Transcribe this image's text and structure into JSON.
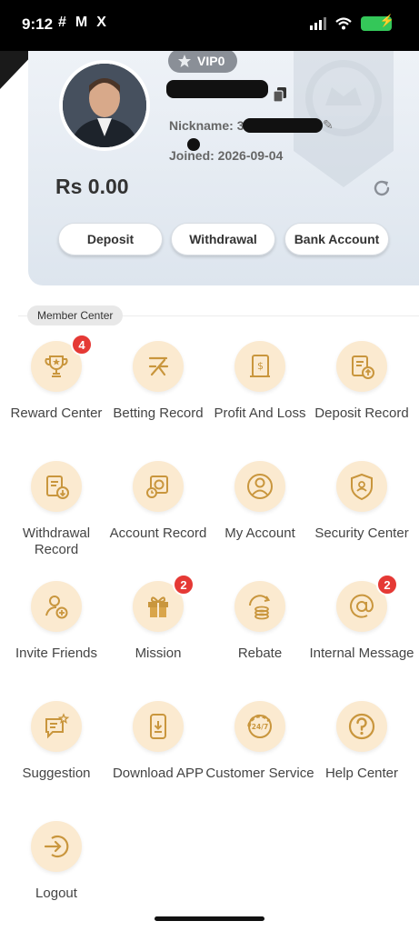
{
  "status_bar": {
    "time": "9:12",
    "apps": [
      "#",
      "M",
      "X"
    ]
  },
  "profile": {
    "vip_label": "VIP0",
    "nickname_label": "Nickname:",
    "nickname_value": "3",
    "joined_label": "Joined:",
    "joined_value": "2026-09-04",
    "balance": "Rs 0.00"
  },
  "actions": {
    "deposit": "Deposit",
    "withdrawal": "Withdrawal",
    "bank_account": "Bank Account"
  },
  "member_center": {
    "label": "Member Center",
    "items": [
      {
        "label": "Reward Center",
        "icon": "trophy-icon",
        "badge": "4"
      },
      {
        "label": "Betting Record",
        "icon": "spark-icon",
        "badge": ""
      },
      {
        "label": "Profit And Loss",
        "icon": "invoice-icon",
        "badge": ""
      },
      {
        "label": "Deposit Record",
        "icon": "clipboard-up-icon",
        "badge": ""
      },
      {
        "label": "Withdrawal Record",
        "icon": "clipboard-down-icon",
        "badge": ""
      },
      {
        "label": "Account Record",
        "icon": "history-icon",
        "badge": ""
      },
      {
        "label": "My Account",
        "icon": "user-icon",
        "badge": ""
      },
      {
        "label": "Security Center",
        "icon": "shield-icon",
        "badge": ""
      },
      {
        "label": "Invite Friends",
        "icon": "add-user-icon",
        "badge": ""
      },
      {
        "label": "Mission",
        "icon": "gift-icon",
        "badge": "2"
      },
      {
        "label": "Rebate",
        "icon": "coins-icon",
        "badge": ""
      },
      {
        "label": "Internal Message",
        "icon": "at-icon",
        "badge": "2"
      },
      {
        "label": "Suggestion",
        "icon": "chat-icon",
        "badge": ""
      },
      {
        "label": "Download APP",
        "icon": "phone-download-icon",
        "badge": ""
      },
      {
        "label": "Customer Service",
        "icon": "headset-24-7-icon",
        "badge": ""
      },
      {
        "label": "Help Center",
        "icon": "question-icon",
        "badge": ""
      },
      {
        "label": "Logout",
        "icon": "logout-icon",
        "badge": ""
      }
    ]
  },
  "colors": {
    "icon_bg": "#fbead0",
    "icon_stroke": "#c9963d",
    "badge": "#e53935"
  }
}
